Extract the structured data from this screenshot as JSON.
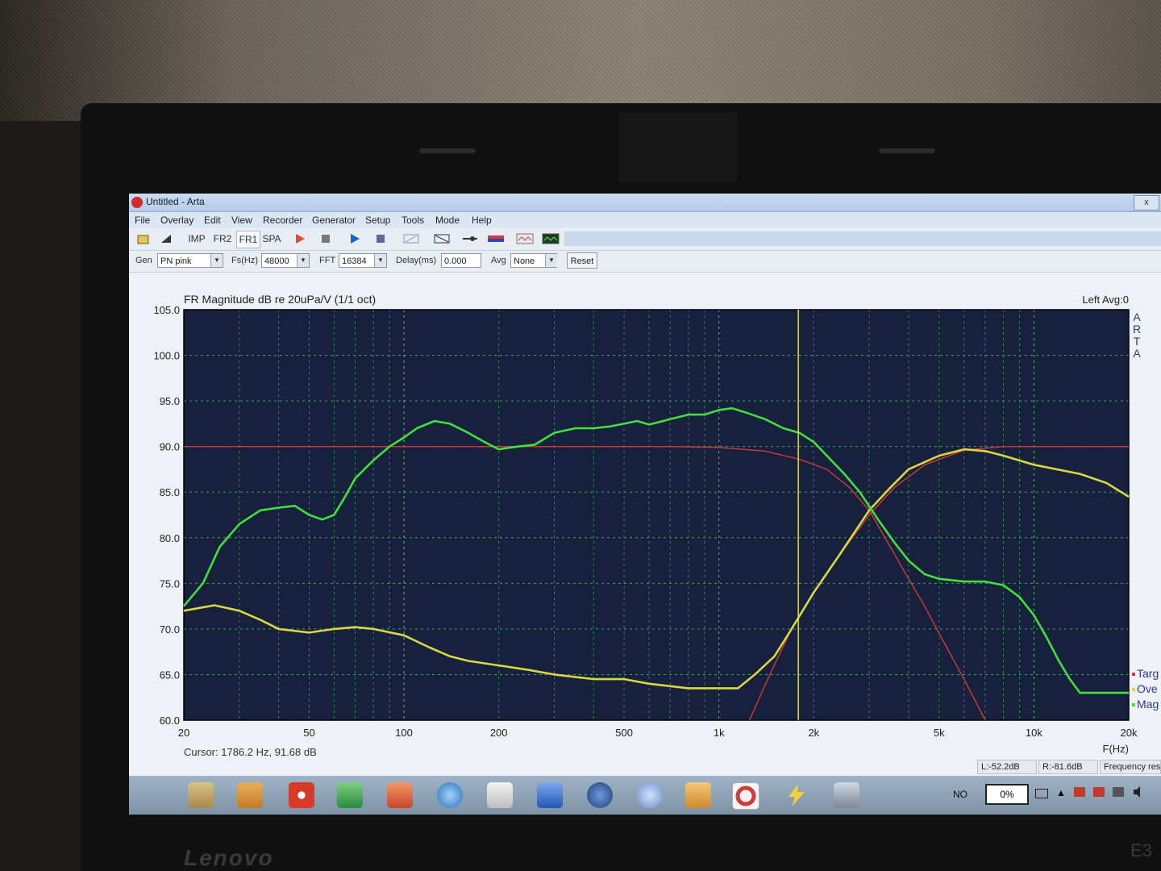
{
  "window": {
    "title": "Untitled - Arta",
    "close_label": "x"
  },
  "menu": [
    "File",
    "Overlay",
    "Edit",
    "View",
    "Recorder",
    "Generator",
    "Setup",
    "Tools",
    "Mode",
    "Help"
  ],
  "toolbar": {
    "imp_label": "IMP",
    "fr2_label": "FR2",
    "fr1_label": "FR1",
    "spa_label": "SPA"
  },
  "params": {
    "gen_label": "Gen",
    "gen_value": "PN pink",
    "fs_label": "Fs(Hz)",
    "fs_value": "48000",
    "fft_label": "FFT",
    "fft_value": "16384",
    "delay_label": "Delay(ms)",
    "delay_value": "0.000",
    "avg_label": "Avg",
    "avg_value": "None",
    "reset_label": "Reset"
  },
  "chart_data": {
    "type": "line",
    "title": "FR Magnitude dB re 20uPa/V (1/1 oct)",
    "channel_label": "Left  Avg:0",
    "brand_vertical": "ARTA",
    "xlabel": "F(Hz)",
    "x_scale": "log",
    "xlim": [
      20,
      20000
    ],
    "ylim": [
      60,
      105
    ],
    "x_tick_labels": [
      {
        "v": 20,
        "t": "20"
      },
      {
        "v": 50,
        "t": "50"
      },
      {
        "v": 100,
        "t": "100"
      },
      {
        "v": 200,
        "t": "200"
      },
      {
        "v": 500,
        "t": "500"
      },
      {
        "v": 1000,
        "t": "1k"
      },
      {
        "v": 2000,
        "t": "2k"
      },
      {
        "v": 5000,
        "t": "5k"
      },
      {
        "v": 10000,
        "t": "10k"
      },
      {
        "v": 20000,
        "t": "20k"
      }
    ],
    "y_tick_labels": [
      "60.0",
      "65.0",
      "70.0",
      "75.0",
      "80.0",
      "85.0",
      "90.0",
      "95.0",
      "100.0",
      "105.0"
    ],
    "cursor": {
      "x": 1786.2,
      "text": "Cursor:  1786.2 Hz, 91.68 dB"
    },
    "legend": [
      "Targ",
      "Ove",
      "Mag"
    ],
    "grid": true,
    "series": [
      {
        "name": "Targ",
        "color": "#d23a3a",
        "points": [
          [
            20,
            90
          ],
          [
            50,
            90
          ],
          [
            100,
            90
          ],
          [
            200,
            90
          ],
          [
            400,
            90
          ],
          [
            700,
            90
          ],
          [
            1000,
            89.9
          ],
          [
            1400,
            89.5
          ],
          [
            1800,
            88.6
          ],
          [
            2200,
            87.5
          ],
          [
            2600,
            85.5
          ],
          [
            3000,
            83
          ],
          [
            3500,
            79
          ],
          [
            4000,
            75.5
          ],
          [
            4500,
            72.5
          ],
          [
            5000,
            69.5
          ],
          [
            6000,
            64.5
          ],
          [
            7000,
            60
          ]
        ]
      },
      {
        "name": "Targ",
        "color": "#d23a3a",
        "points": [
          [
            1250,
            60
          ],
          [
            1450,
            65
          ],
          [
            1700,
            70
          ],
          [
            2000,
            74
          ],
          [
            2400,
            78
          ],
          [
            3000,
            82.5
          ],
          [
            3600,
            85.5
          ],
          [
            4500,
            88
          ],
          [
            6000,
            89.6
          ],
          [
            8000,
            90
          ],
          [
            12000,
            90
          ],
          [
            20000,
            90
          ]
        ]
      },
      {
        "name": "Ove",
        "color": "#d8d840",
        "points": [
          [
            20,
            72
          ],
          [
            25,
            72.6
          ],
          [
            30,
            72
          ],
          [
            35,
            71
          ],
          [
            40,
            70
          ],
          [
            50,
            69.6
          ],
          [
            60,
            70
          ],
          [
            70,
            70.2
          ],
          [
            80,
            70
          ],
          [
            100,
            69.3
          ],
          [
            120,
            68
          ],
          [
            140,
            67
          ],
          [
            160,
            66.5
          ],
          [
            200,
            66
          ],
          [
            250,
            65.5
          ],
          [
            300,
            65
          ],
          [
            400,
            64.5
          ],
          [
            500,
            64.5
          ],
          [
            600,
            64
          ],
          [
            800,
            63.5
          ],
          [
            1000,
            63.5
          ],
          [
            1150,
            63.5
          ],
          [
            1300,
            65
          ],
          [
            1500,
            67
          ],
          [
            1700,
            70
          ],
          [
            2000,
            74
          ],
          [
            2400,
            78
          ],
          [
            3000,
            83
          ],
          [
            3500,
            85.5
          ],
          [
            4000,
            87.5
          ],
          [
            5000,
            89
          ],
          [
            6000,
            89.7
          ],
          [
            7000,
            89.5
          ],
          [
            8000,
            89
          ],
          [
            10000,
            88
          ],
          [
            14000,
            87
          ],
          [
            17000,
            86
          ],
          [
            20000,
            84.5
          ]
        ]
      },
      {
        "name": "Mag",
        "color": "#41e03a",
        "points": [
          [
            20,
            72.5
          ],
          [
            23,
            75
          ],
          [
            26,
            79
          ],
          [
            30,
            81.5
          ],
          [
            35,
            83
          ],
          [
            40,
            83.3
          ],
          [
            45,
            83.5
          ],
          [
            50,
            82.5
          ],
          [
            55,
            82
          ],
          [
            60,
            82.5
          ],
          [
            65,
            84.5
          ],
          [
            70,
            86.5
          ],
          [
            80,
            88.5
          ],
          [
            90,
            90
          ],
          [
            100,
            91
          ],
          [
            110,
            92
          ],
          [
            125,
            92.8
          ],
          [
            140,
            92.5
          ],
          [
            160,
            91.5
          ],
          [
            180,
            90.5
          ],
          [
            200,
            89.7
          ],
          [
            230,
            90
          ],
          [
            260,
            90.2
          ],
          [
            300,
            91.5
          ],
          [
            350,
            92
          ],
          [
            400,
            92
          ],
          [
            450,
            92.2
          ],
          [
            500,
            92.5
          ],
          [
            550,
            92.8
          ],
          [
            600,
            92.4
          ],
          [
            700,
            93
          ],
          [
            800,
            93.5
          ],
          [
            900,
            93.5
          ],
          [
            1000,
            94
          ],
          [
            1100,
            94.2
          ],
          [
            1200,
            93.8
          ],
          [
            1400,
            93
          ],
          [
            1600,
            92
          ],
          [
            1800,
            91.5
          ],
          [
            2000,
            90.5
          ],
          [
            2200,
            89
          ],
          [
            2500,
            87
          ],
          [
            2800,
            85
          ],
          [
            3200,
            82
          ],
          [
            3600,
            79.5
          ],
          [
            4000,
            77.5
          ],
          [
            4500,
            76
          ],
          [
            5000,
            75.5
          ],
          [
            6000,
            75.2
          ],
          [
            7000,
            75.2
          ],
          [
            8000,
            74.8
          ],
          [
            9000,
            73.5
          ],
          [
            10000,
            71.5
          ],
          [
            11000,
            69
          ],
          [
            12000,
            66.5
          ],
          [
            13000,
            64.5
          ],
          [
            14000,
            63
          ],
          [
            16000,
            63
          ],
          [
            20000,
            63
          ]
        ]
      }
    ]
  },
  "status": {
    "l_value": "L:-52.2dB",
    "r_value": "R:-81.6dB",
    "mode_text": "Frequency resp"
  },
  "tray": {
    "lang": "NO",
    "percent": "0%"
  },
  "brand": "Lenovo",
  "model": "E3"
}
